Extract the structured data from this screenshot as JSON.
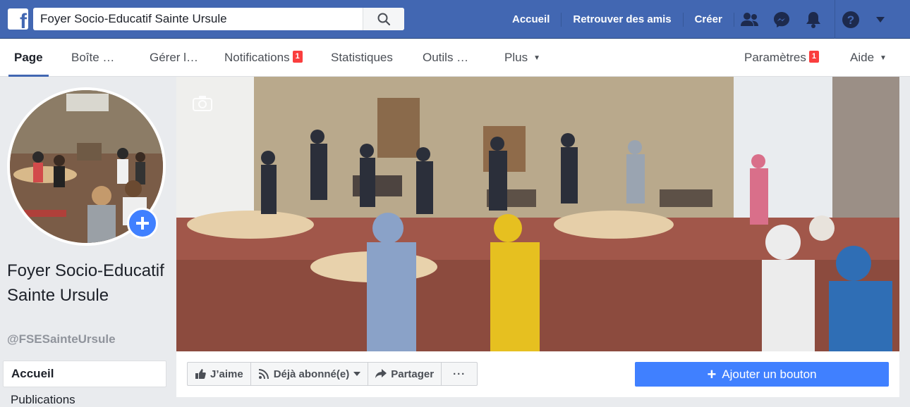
{
  "topbar": {
    "search_value": "Foyer Socio-Educatif Sainte Ursule",
    "links": [
      "Accueil",
      "Retrouver des amis",
      "Créer"
    ]
  },
  "tabs": {
    "page": "Page",
    "inbox": "Boîte …",
    "manage": "Gérer l…",
    "notifications": "Notifications",
    "notifications_badge": "1",
    "stats": "Statistiques",
    "tools": "Outils …",
    "more": "Plus",
    "settings": "Paramètres",
    "settings_badge": "1",
    "help": "Aide"
  },
  "sidebar": {
    "page_name": "Foyer Socio-Educatif Sainte Ursule",
    "handle": "@FSESainteUrsule",
    "nav_active": "Accueil",
    "nav_next": "Publications"
  },
  "actions": {
    "like": "J’aime",
    "subscribed": "Déjà abonné(e)",
    "share": "Partager",
    "more": "···",
    "add_button": "Ajouter un bouton"
  },
  "colors": {
    "brand": "#4267b2",
    "accent": "#4080ff",
    "badge": "#fa3e3e"
  }
}
